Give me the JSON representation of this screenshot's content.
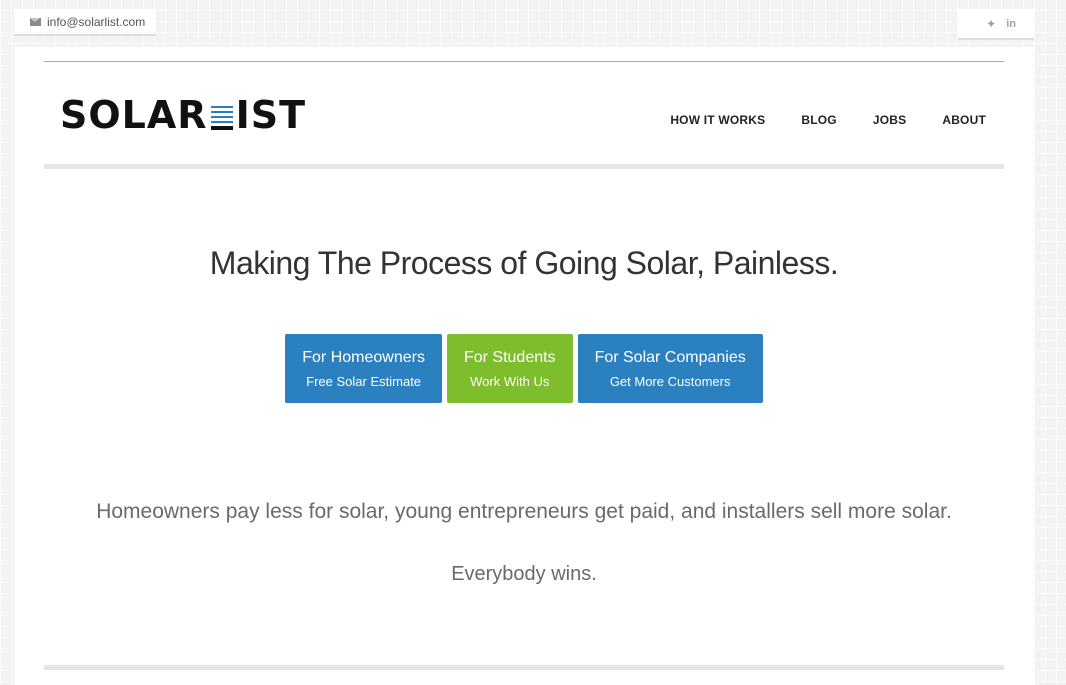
{
  "topbar": {
    "email": "info@solarlist.com",
    "social": {
      "twitter_icon": "twitter-icon",
      "linkedin_label": "in"
    }
  },
  "logo": {
    "left": "SOLAR",
    "right": "IST"
  },
  "nav": {
    "items": [
      {
        "label": "HOW IT WORKS"
      },
      {
        "label": "BLOG"
      },
      {
        "label": "JOBS"
      },
      {
        "label": "ABOUT"
      }
    ]
  },
  "hero": {
    "headline": "Making The Process of Going Solar, Painless.",
    "ctas": [
      {
        "title": "For Homeowners",
        "subtitle": "Free Solar Estimate",
        "color": "#2b80bf"
      },
      {
        "title": "For Students",
        "subtitle": "Work With Us",
        "color": "#7ebd2b"
      },
      {
        "title": "For Solar Companies",
        "subtitle": "Get More Customers",
        "color": "#2b80bf"
      }
    ],
    "tagline": "Homeowners pay less for solar, young entrepreneurs get paid, and installers sell more solar.",
    "closing": "Everybody wins."
  },
  "colors": {
    "accent_blue": "#2b80bf",
    "accent_green": "#7ebd2b",
    "text": "#333333"
  }
}
